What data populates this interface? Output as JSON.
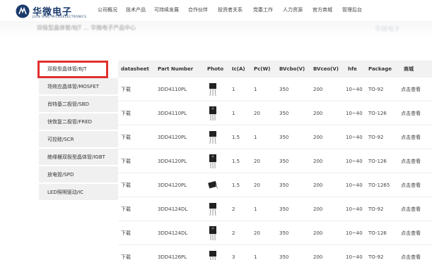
{
  "brand": {
    "name": "华微电子",
    "sub": "JILIN SINO-MICROELECTRONICS"
  },
  "nav": [
    "公司概况",
    "技术产品",
    "可持续发展",
    "合作伙伴",
    "投资者关系",
    "党委工作",
    "人力资源",
    "官方商城",
    "管理后台"
  ],
  "banner": {
    "text": "双极型晶体管/BJT ... 华微电子产品中心"
  },
  "sidebar": {
    "items": [
      {
        "label": "双极型晶体管/BJT",
        "active": true
      },
      {
        "label": "场效应晶体管/MOSFET"
      },
      {
        "label": "肖特基二极管/SBD"
      },
      {
        "label": "快恢复二极管/FRED"
      },
      {
        "label": "可控硅/SCR"
      },
      {
        "label": "绝缘栅双极型晶体管/IGBT"
      },
      {
        "label": "放电管/SPD"
      },
      {
        "label": "LED照明驱动/IC"
      }
    ]
  },
  "table": {
    "headers": [
      "datasheet",
      "Part Number",
      "Photo",
      "Ic(A)",
      "Pc(W)",
      "BVcbo(V)",
      "BVceo(V)",
      "hfe",
      "Package",
      "商城"
    ],
    "rows": [
      {
        "datasheet": "下载",
        "part": "3DD4110PL",
        "ic": "1",
        "pc": "1",
        "bvcbo": "350",
        "bvceo": "200",
        "hfe": "10~40",
        "pkg": "TO-92",
        "shop": "点击查看",
        "photo": "to92"
      },
      {
        "datasheet": "下载",
        "part": "3DD4110PL",
        "ic": "1",
        "pc": "20",
        "bvcbo": "350",
        "bvceo": "200",
        "hfe": "10~40",
        "pkg": "TO-126",
        "shop": "点击查看",
        "photo": "to126"
      },
      {
        "datasheet": "下载",
        "part": "3DD4120PL",
        "ic": "1.5",
        "pc": "1",
        "bvcbo": "350",
        "bvceo": "200",
        "hfe": "10~40",
        "pkg": "TO-92",
        "shop": "点击查看",
        "photo": "to92"
      },
      {
        "datasheet": "下载",
        "part": "3DD4120PL",
        "ic": "1.5",
        "pc": "20",
        "bvcbo": "350",
        "bvceo": "200",
        "hfe": "10~40",
        "pkg": "TO-126",
        "shop": "点击查看",
        "photo": "to126"
      },
      {
        "datasheet": "下载",
        "part": "3DD4120PL",
        "ic": "1.5",
        "pc": "20",
        "bvcbo": "350",
        "bvceo": "200",
        "hfe": "10~40",
        "pkg": "TO-1265",
        "shop": "点击查看",
        "photo": "to126s"
      },
      {
        "datasheet": "下载",
        "part": "3DD4124DL",
        "ic": "2",
        "pc": "1",
        "bvcbo": "350",
        "bvceo": "200",
        "hfe": "10~40",
        "pkg": "TO-92",
        "shop": "点击查看",
        "photo": "to92"
      },
      {
        "datasheet": "下载",
        "part": "3DD4124DL",
        "ic": "2",
        "pc": "20",
        "bvcbo": "350",
        "bvceo": "200",
        "hfe": "10~40",
        "pkg": "TO-126",
        "shop": "点击查看",
        "photo": "to126"
      },
      {
        "datasheet": "下载",
        "part": "3DD4126PL",
        "ic": "3",
        "pc": "1",
        "bvcbo": "350",
        "bvceo": "200",
        "hfe": "10~40",
        "pkg": "TO-92",
        "shop": "点击查看",
        "photo": "to92"
      }
    ]
  },
  "colors": {
    "brand": "#1a3a6b",
    "highlight": "#e03030",
    "header_bg": "#f2f2f2"
  }
}
